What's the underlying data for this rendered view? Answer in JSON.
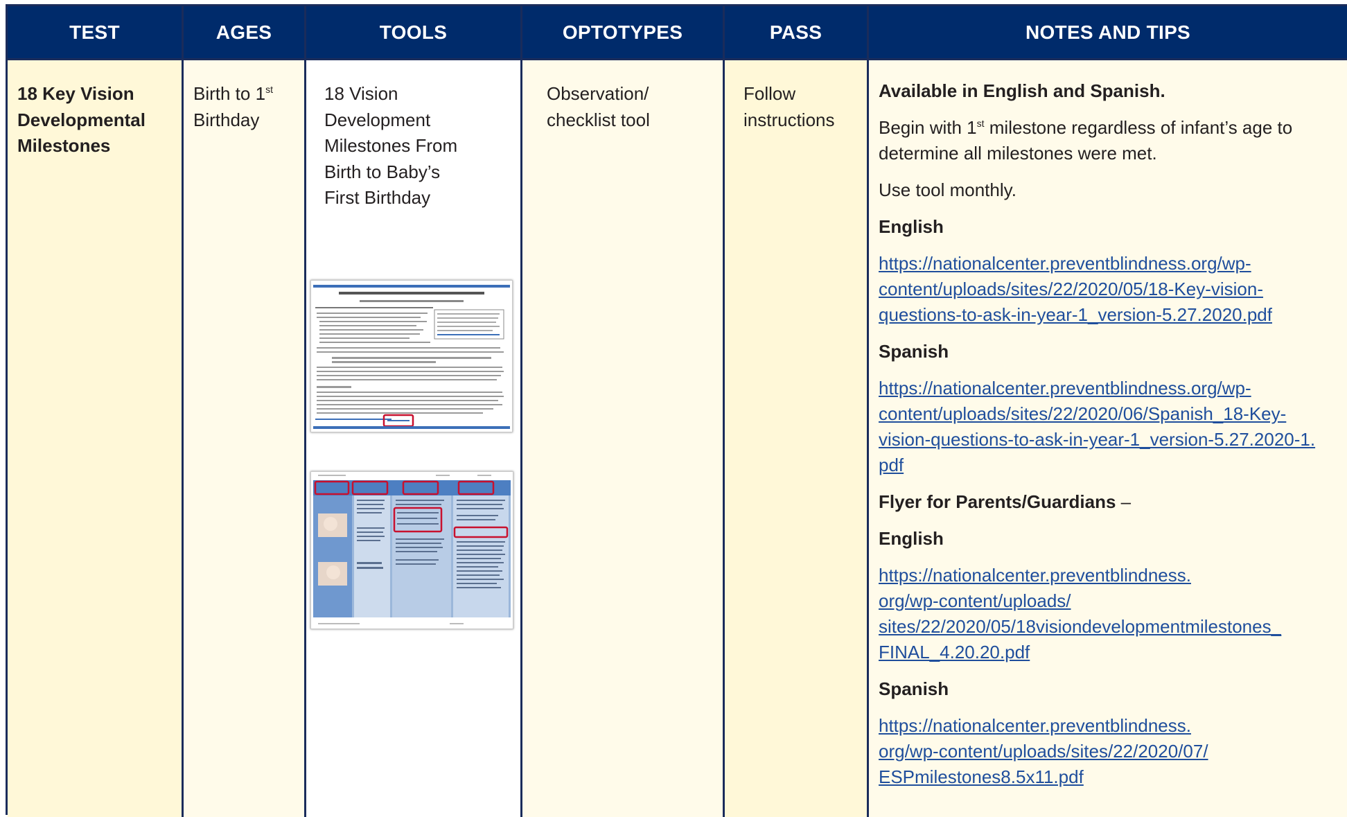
{
  "headers": [
    "TEST",
    "AGES",
    "TOOLS",
    "OPTOTYPES",
    "PASS",
    "NOTES AND TIPS"
  ],
  "row": {
    "test": "18 Key Vision Developmental Milestones",
    "ages_prefix": "Birth to 1",
    "ages_sup": "st",
    "ages_suffix": "Birthday",
    "tools": "18 Vision Development Milestones From Birth to Baby’s First Birthday",
    "optotypes": "Observation/ checklist tool",
    "pass": "Follow instructions",
    "notes": {
      "availability": "Available in English and Spanish.",
      "begin_prefix": "Begin with 1",
      "begin_sup": "st",
      "begin_suffix": " milestone regardless of infant’s age to determine all milestones were met.",
      "monthly": "Use tool monthly.",
      "english_label": "English",
      "english_link_lines": [
        "https://nationalcenter.preventblindness.org/wp-",
        "content/uploads/sites/22/2020/05/18-Key-vision-",
        "questions-to-ask-in-year-1_version-5.27.2020.pdf"
      ],
      "spanish_label": "Spanish",
      "spanish_link_lines": [
        "https://nationalcenter.preventblindness.org/wp-",
        "content/uploads/sites/22/2020/06/Spanish_18-Key-",
        "vision-questions-to-ask-in-year-1_version-5.27.2020-1.",
        "pdf"
      ],
      "flyer_label": "Flyer for Parents/Guardians",
      "flyer_dash": " –",
      "flyer_english_label": "English",
      "flyer_english_link_lines": [
        "https://nationalcenter.preventblindness.",
        "org/wp-content/uploads/",
        "sites/22/2020/05/18visiondevelopmentmilestones_",
        "FINAL_4.20.20.pdf"
      ],
      "flyer_spanish_label": "Spanish",
      "flyer_spanish_link_lines": [
        "https://nationalcenter.preventblindness.",
        "org/wp-content/uploads/sites/22/2020/07/",
        "ESPmilestones8.5x11.pdf"
      ]
    }
  },
  "colors": {
    "header_bg": "#002b6b",
    "header_text": "#ffffff",
    "border": "#1a2c5b",
    "highlight_yellow": "#fff8d8",
    "highlight_cream": "#fffbea",
    "link": "#1f4e9c"
  }
}
